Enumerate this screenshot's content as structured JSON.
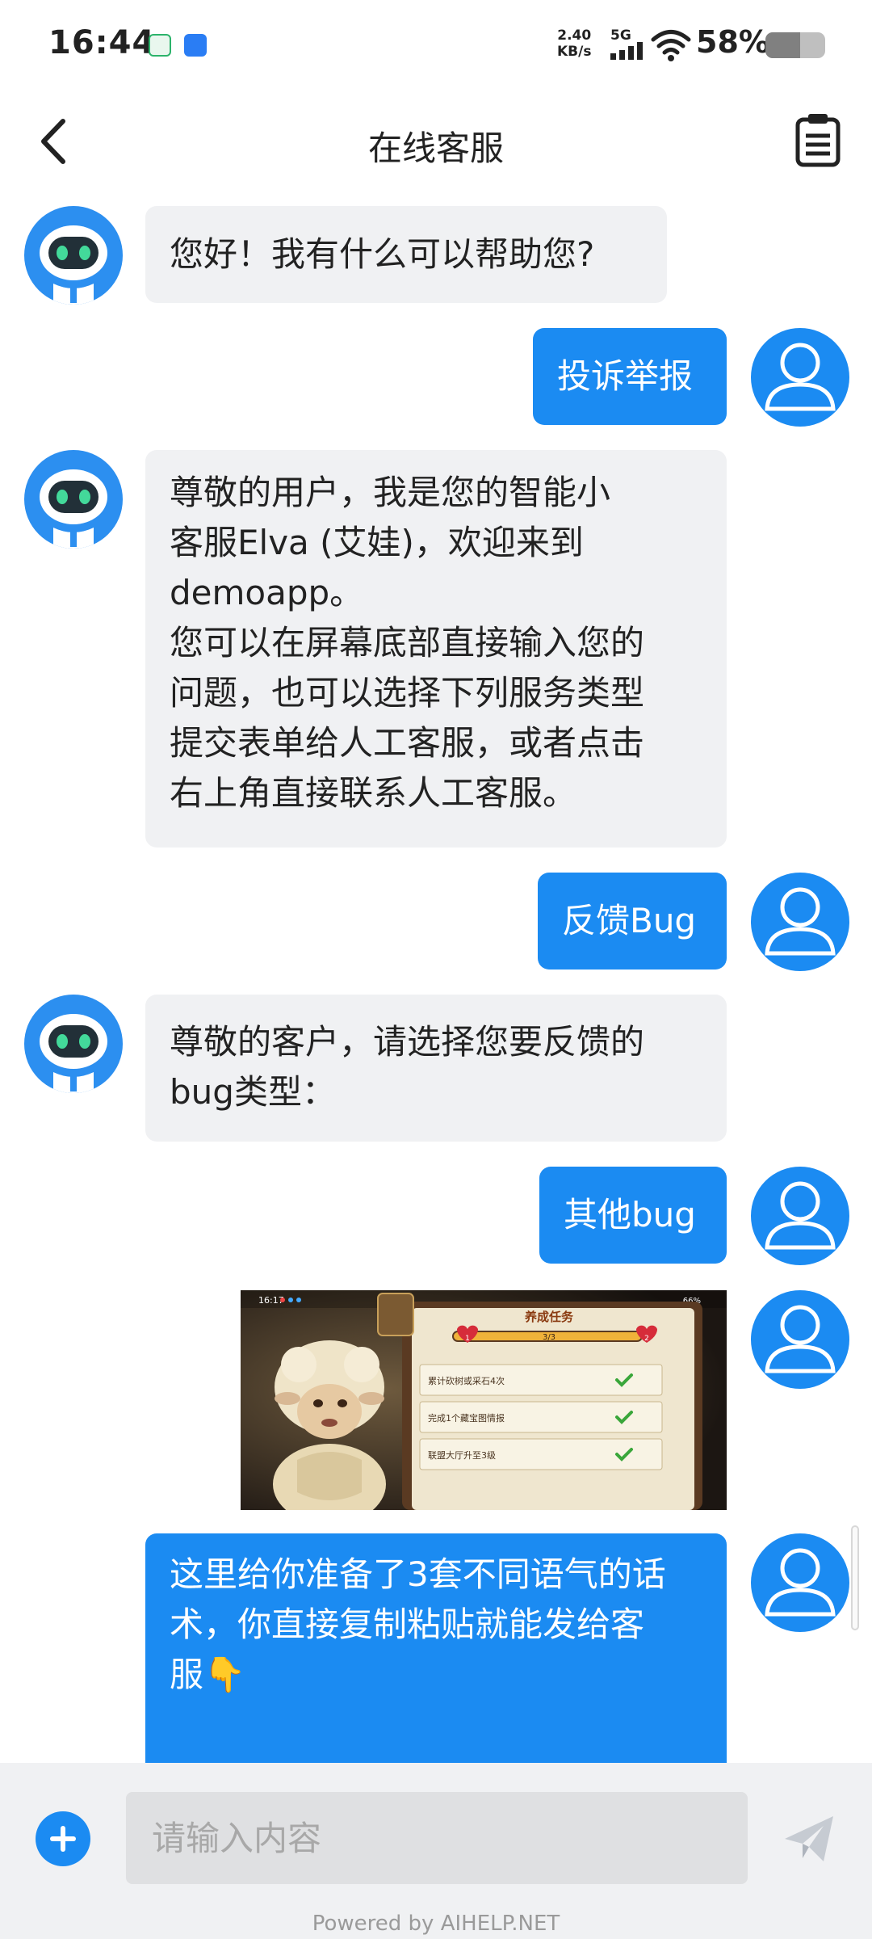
{
  "status_bar": {
    "time": "16:44",
    "net_speed_value": "2.40",
    "net_speed_unit": "KB/s",
    "network": "5G",
    "battery": "58%",
    "battery_level": 0.58
  },
  "header": {
    "title": "在线客服",
    "back_icon": "chevron-left-icon",
    "ticket_icon": "clipboard-list-icon"
  },
  "messages": [
    {
      "sender": "bot",
      "lines": [
        "您好！我有什么可以帮助您?"
      ]
    },
    {
      "sender": "user",
      "lines": [
        "投诉举报"
      ]
    },
    {
      "sender": "bot",
      "lines": [
        "尊敬的用户，我是您的智能小",
        "客服Elva (艾娃)，欢迎来到",
        "demoapp。",
        "您可以在屏幕底部直接输入您的",
        "问题，也可以选择下列服务类型",
        "提交表单给人工客服，或者点击",
        "右上角直接联系人工客服。"
      ]
    },
    {
      "sender": "user",
      "lines": [
        "反馈Bug"
      ]
    },
    {
      "sender": "bot",
      "lines": [
        "尊敬的客户，请选择您要反馈的",
        "bug类型："
      ]
    },
    {
      "sender": "user",
      "lines": [
        "其他bug"
      ]
    },
    {
      "sender": "user",
      "type": "image"
    },
    {
      "sender": "user",
      "lines": [
        "这里给你准备了3套不同语气的话",
        "术，你直接复制粘贴就能发给客",
        "服👇"
      ]
    }
  ],
  "screenshot_attachment": {
    "time": "16:17",
    "battery": "66%",
    "panel_title": "养成任务",
    "progress": "3/3",
    "progress_fraction": 1.0,
    "level_left": "1",
    "level_right": "2",
    "tasks": [
      "累计砍树或采石4次",
      "完成1个藏宝图情报",
      "联盟大厅升至3级"
    ]
  },
  "input": {
    "placeholder": "请输入内容",
    "add_icon": "plus-circle-icon",
    "send_icon": "send-icon"
  },
  "footer": {
    "powered_by": "Powered by AIHELP.NET"
  },
  "colors": {
    "accent": "#1b8bf2",
    "bot_bubble": "#f0f1f3",
    "input_bar": "#f0f1f3"
  }
}
